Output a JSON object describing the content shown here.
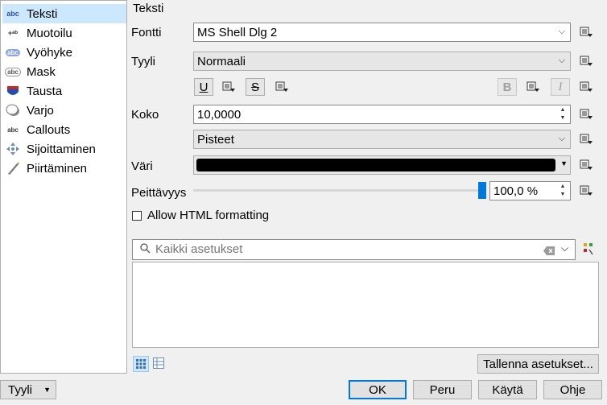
{
  "nav": [
    {
      "label": "Teksti",
      "icon": "abc-text-icon",
      "glyph": "abc"
    },
    {
      "label": "Muotoilu",
      "icon": "formatting-icon",
      "glyph": "+ab"
    },
    {
      "label": "Vyöhyke",
      "icon": "buffer-icon",
      "glyph": "abc"
    },
    {
      "label": "Mask",
      "icon": "mask-icon",
      "glyph": "abc"
    },
    {
      "label": "Tausta",
      "icon": "background-icon",
      "glyph": ""
    },
    {
      "label": "Varjo",
      "icon": "shadow-icon",
      "glyph": ""
    },
    {
      "label": "Callouts",
      "icon": "callouts-icon",
      "glyph": "abc"
    },
    {
      "label": "Sijoittaminen",
      "icon": "placement-icon",
      "glyph": ""
    },
    {
      "label": "Piirtäminen",
      "icon": "rendering-icon",
      "glyph": ""
    }
  ],
  "section_title": "Teksti",
  "font": {
    "label": "Fontti",
    "value": "MS Shell Dlg 2"
  },
  "style": {
    "label": "Tyyli",
    "value": "Normaali"
  },
  "format_buttons": {
    "underline": "U",
    "strike": "S",
    "bold": "B",
    "italic": "I"
  },
  "size": {
    "label": "Koko",
    "value": "10,0000",
    "unit": "Pisteet"
  },
  "color": {
    "label": "Väri",
    "swatch": "#000000"
  },
  "opacity": {
    "label": "Peittävyys",
    "value": "100,0 %",
    "level": 1.0
  },
  "html_checkbox": {
    "label": "Allow HTML formatting",
    "checked": false
  },
  "search": {
    "placeholder": "Kaikki asetukset"
  },
  "save_settings": "Tallenna asetukset...",
  "bottom": {
    "style_button": "Tyyli",
    "ok": "OK",
    "cancel": "Peru",
    "apply": "Käytä",
    "help": "Ohje"
  },
  "colors": {
    "selection": "#cce8ff",
    "accent": "#0078d7"
  }
}
